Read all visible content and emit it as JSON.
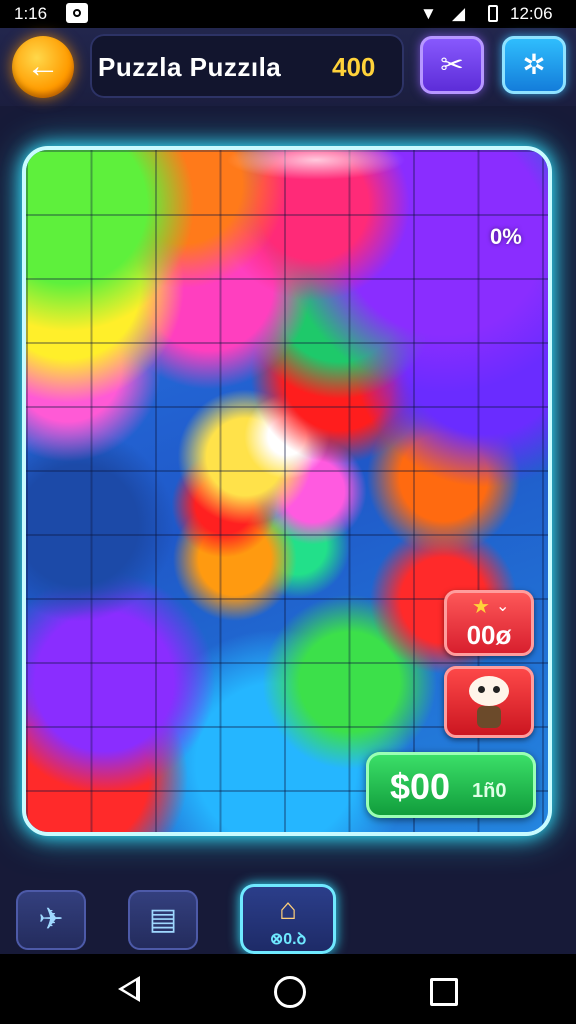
{
  "status_bar": {
    "time_left": "1:16",
    "time_right": "12:06"
  },
  "header": {
    "back_icon": "←",
    "title": "Puzzla Puzzıla",
    "score": "400",
    "tool_purple_icon": "✂",
    "tool_blue_icon": "✲"
  },
  "board": {
    "progress": "0%"
  },
  "side_buttons": {
    "hint_star_icon": "★",
    "hint_chevron_icon": "⌄",
    "hint_count": "00ø"
  },
  "buy_button": {
    "price": "$00",
    "sub": "1ñ0"
  },
  "bottom_tools": {
    "rocket_icon": "✈",
    "save_icon": "▤",
    "home_icon": "⌂",
    "home_count": "⊗0.ꝺ"
  },
  "colors": {
    "board_glow": "#34e6ff",
    "score": "#ffd23a",
    "buy": "#1fbf4e",
    "hint": "#e02a35"
  }
}
